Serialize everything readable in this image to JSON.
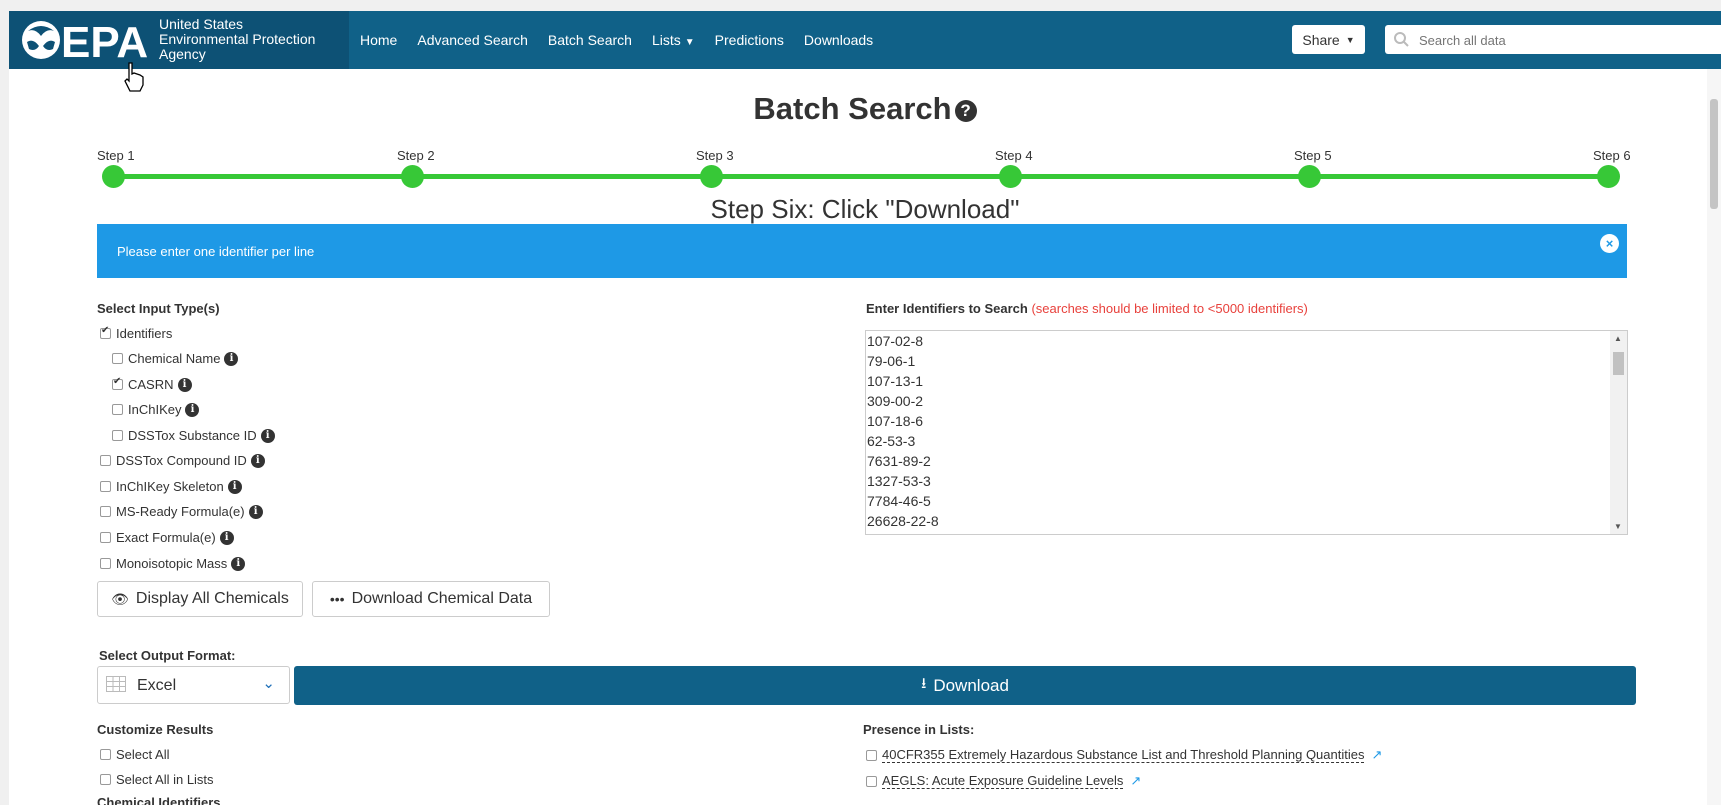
{
  "navbar": {
    "brand": "EPA",
    "agency_lines": [
      "United States",
      "Environmental Protection",
      "Agency"
    ],
    "links": [
      {
        "label": "Home"
      },
      {
        "label": "Advanced Search"
      },
      {
        "label": "Batch Search"
      },
      {
        "label": "Lists",
        "dropdown": true
      },
      {
        "label": "Predictions"
      },
      {
        "label": "Downloads"
      }
    ],
    "share_label": "Share",
    "search_placeholder": "Search all data"
  },
  "page": {
    "title": "Batch Search",
    "steps": [
      "Step 1",
      "Step 2",
      "Step 3",
      "Step 4",
      "Step 5",
      "Step 6"
    ],
    "step_heading": "Step Six: Click \"Download\"",
    "alert_text": "Please enter one identifier per line",
    "alert_close": "×"
  },
  "input_types": {
    "label": "Select Input Type(s)",
    "items": [
      {
        "label": "Identifiers",
        "checked": true,
        "info": false
      },
      {
        "label": "Chemical Name",
        "checked": false,
        "info": true
      },
      {
        "label": "CASRN",
        "checked": true,
        "info": true
      },
      {
        "label": "InChIKey",
        "checked": false,
        "info": true
      },
      {
        "label": "DSSTox Substance ID",
        "checked": false,
        "info": true
      },
      {
        "label": "DSSTox Compound ID",
        "checked": false,
        "info": true
      },
      {
        "label": "InChIKey Skeleton",
        "checked": false,
        "info": true
      },
      {
        "label": "MS-Ready Formula(e)",
        "checked": false,
        "info": true
      },
      {
        "label": "Exact Formula(e)",
        "checked": false,
        "info": true
      },
      {
        "label": "Monoisotopic Mass",
        "checked": false,
        "info": true
      }
    ]
  },
  "buttons": {
    "display_all": "Display All Chemicals",
    "download_chemical_data": "Download Chemical Data"
  },
  "identifiers": {
    "label": "Enter Identifiers to Search",
    "warning": "(searches should be limited to <5000 identifiers)",
    "values": [
      "107-02-8",
      "79-06-1",
      "107-13-1",
      "309-00-2",
      "107-18-6",
      "62-53-3",
      "7631-89-2",
      "1327-53-3",
      "7784-46-5",
      "26628-22-8"
    ]
  },
  "output": {
    "label": "Select Output Format:",
    "selected": "Excel",
    "download_label": "Download"
  },
  "customize": {
    "label": "Customize Results",
    "items": [
      {
        "label": "Select All",
        "checked": false
      },
      {
        "label": "Select All in Lists",
        "checked": false
      }
    ],
    "next_heading": "Chemical Identifiers"
  },
  "presence": {
    "label": "Presence in Lists:",
    "items": [
      {
        "label": "40CFR355 Extremely Hazardous Substance List and Threshold Planning Quantities",
        "checked": false
      },
      {
        "label": "AEGLS: Acute Exposure Guideline Levels",
        "checked": false
      }
    ]
  },
  "colors": {
    "navbar": "#106188",
    "step_green": "#37c837",
    "alert_blue": "#1e99e6",
    "warning_red": "#e8413c"
  }
}
